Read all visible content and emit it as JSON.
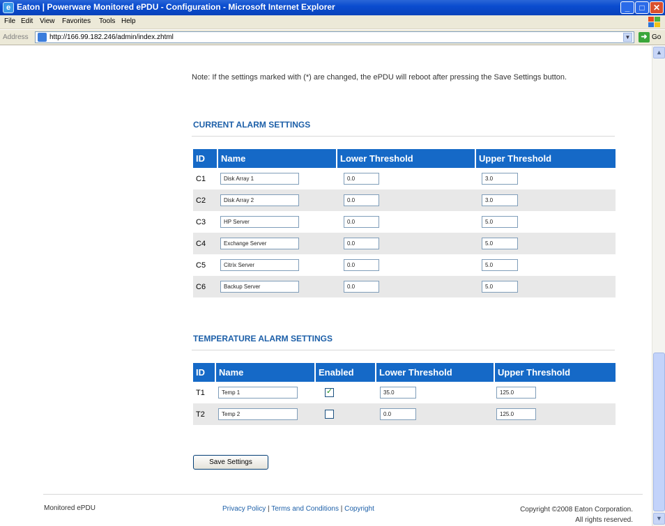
{
  "window": {
    "title": "Eaton | Powerware Monitored ePDU - Configuration - Microsoft Internet Explorer",
    "icon": "ie-icon",
    "buttons": {
      "minimize": "minimize-icon",
      "maximize": "maximize-icon",
      "close": "close-icon"
    }
  },
  "menu": [
    "File",
    "Edit",
    "View",
    "Favorites",
    "Tools",
    "Help"
  ],
  "address": {
    "label": "Address",
    "url": "http://166.99.182.246/admin/index.zhtml",
    "go_label": "Go"
  },
  "page": {
    "note": "Note: If the settings marked with (*) are changed, the ePDU will reboot after pressing the Save Settings button.",
    "current": {
      "title": "CURRENT ALARM SETTINGS",
      "headers": [
        "ID",
        "Name",
        "Lower Threshold",
        "Upper Threshold"
      ],
      "rows": [
        {
          "id": "C1",
          "name": "Disk Array 1",
          "lower": "0.0",
          "upper": "3.0"
        },
        {
          "id": "C2",
          "name": "Disk Array 2",
          "lower": "0.0",
          "upper": "3.0"
        },
        {
          "id": "C3",
          "name": "HP Server",
          "lower": "0.0",
          "upper": "5.0"
        },
        {
          "id": "C4",
          "name": "Exchange Server",
          "lower": "0.0",
          "upper": "5.0"
        },
        {
          "id": "C5",
          "name": "Citrix Server",
          "lower": "0.0",
          "upper": "5.0"
        },
        {
          "id": "C6",
          "name": "Backup Server",
          "lower": "0.0",
          "upper": "5.0"
        }
      ]
    },
    "temperature": {
      "title": "TEMPERATURE ALARM SETTINGS",
      "headers": [
        "ID",
        "Name",
        "Enabled",
        "Lower Threshold",
        "Upper Threshold"
      ],
      "rows": [
        {
          "id": "T1",
          "name": "Temp 1",
          "enabled": true,
          "lower": "35.0",
          "upper": "125.0"
        },
        {
          "id": "T2",
          "name": "Temp 2",
          "enabled": false,
          "lower": "0.0",
          "upper": "125.0"
        }
      ]
    },
    "save_label": "Save Settings"
  },
  "footer": {
    "left": "Monitored ePDU",
    "links": [
      "Privacy Policy",
      "Terms and Conditions",
      "Copyright"
    ],
    "copyright_line1": "Copyright ©2008 Eaton Corporation.",
    "copyright_line2": "All rights reserved."
  },
  "colors": {
    "header_blue": "#1569c7",
    "title_blue": "#1c5fa8",
    "alt_row": "#e8e8e8"
  }
}
